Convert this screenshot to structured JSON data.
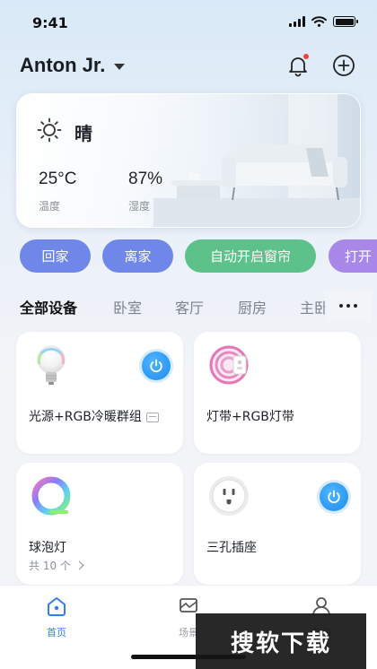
{
  "status_bar": {
    "time": "9:41"
  },
  "header": {
    "user_name": "Anton Jr."
  },
  "weather": {
    "condition": "晴",
    "temperature": "25°C",
    "temperature_label": "温度",
    "humidity": "87%",
    "humidity_label": "湿度"
  },
  "scenes": [
    {
      "label": "回家",
      "color": "#6f87e8"
    },
    {
      "label": "离家",
      "color": "#6f87e8"
    },
    {
      "label": "自动开启窗帘",
      "color": "#5cc28a"
    },
    {
      "label": "打开",
      "color": "#a887e8"
    }
  ],
  "tabs": [
    "全部设备",
    "卧室",
    "客厅",
    "厨房",
    "主卧"
  ],
  "devices": [
    {
      "name": "光源+RGB冷暖群组",
      "icon": "light-bulb-icon",
      "power": "on",
      "group": true
    },
    {
      "name": "灯带+RGB灯带",
      "icon": "light-strip-icon"
    },
    {
      "name": "球泡灯",
      "icon": "rgb-ring-icon",
      "count": "共 10 个"
    },
    {
      "name": "三孔插座",
      "icon": "socket-icon",
      "power": "on"
    }
  ],
  "nav": [
    {
      "label": "首页",
      "icon": "home-icon"
    },
    {
      "label": "场景",
      "icon": "scene-icon"
    },
    {
      "label": "我的",
      "icon": "profile-icon"
    }
  ],
  "watermark": "搜软下载",
  "colors": {
    "accent": "#2f7ef5",
    "power": "#1d8ef0"
  }
}
